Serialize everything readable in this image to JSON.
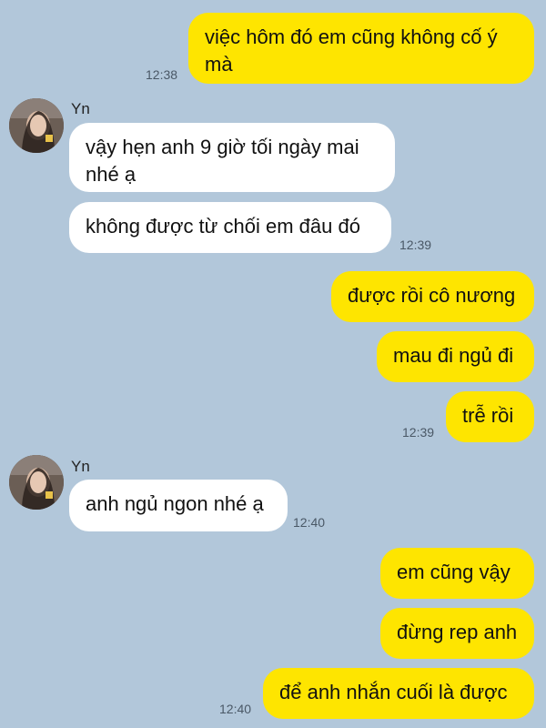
{
  "contact": {
    "name": "Yn"
  },
  "messages": [
    {
      "side": "out",
      "text": "việc hôm đó em cũng không cố ý mà",
      "time": "12:38"
    },
    {
      "side": "in",
      "text": "vậy hẹn anh 9 giờ tối ngày mai nhé ạ"
    },
    {
      "side": "in",
      "text": "không được từ chối em đâu đó",
      "time": "12:39"
    },
    {
      "side": "out",
      "text": "được rồi cô nương"
    },
    {
      "side": "out",
      "text": "mau đi ngủ đi"
    },
    {
      "side": "out",
      "text": "trễ rồi",
      "time": "12:39"
    },
    {
      "side": "in",
      "text": "anh ngủ ngon nhé ạ",
      "time": "12:40"
    },
    {
      "side": "out",
      "text": "em cũng vậy"
    },
    {
      "side": "out",
      "text": "đừng rep anh"
    },
    {
      "side": "out",
      "text": "để anh nhắn cuối là được",
      "time": "12:40"
    }
  ],
  "colors": {
    "background": "#b2c7da",
    "outgoing": "#fee500",
    "incoming": "#ffffff"
  }
}
